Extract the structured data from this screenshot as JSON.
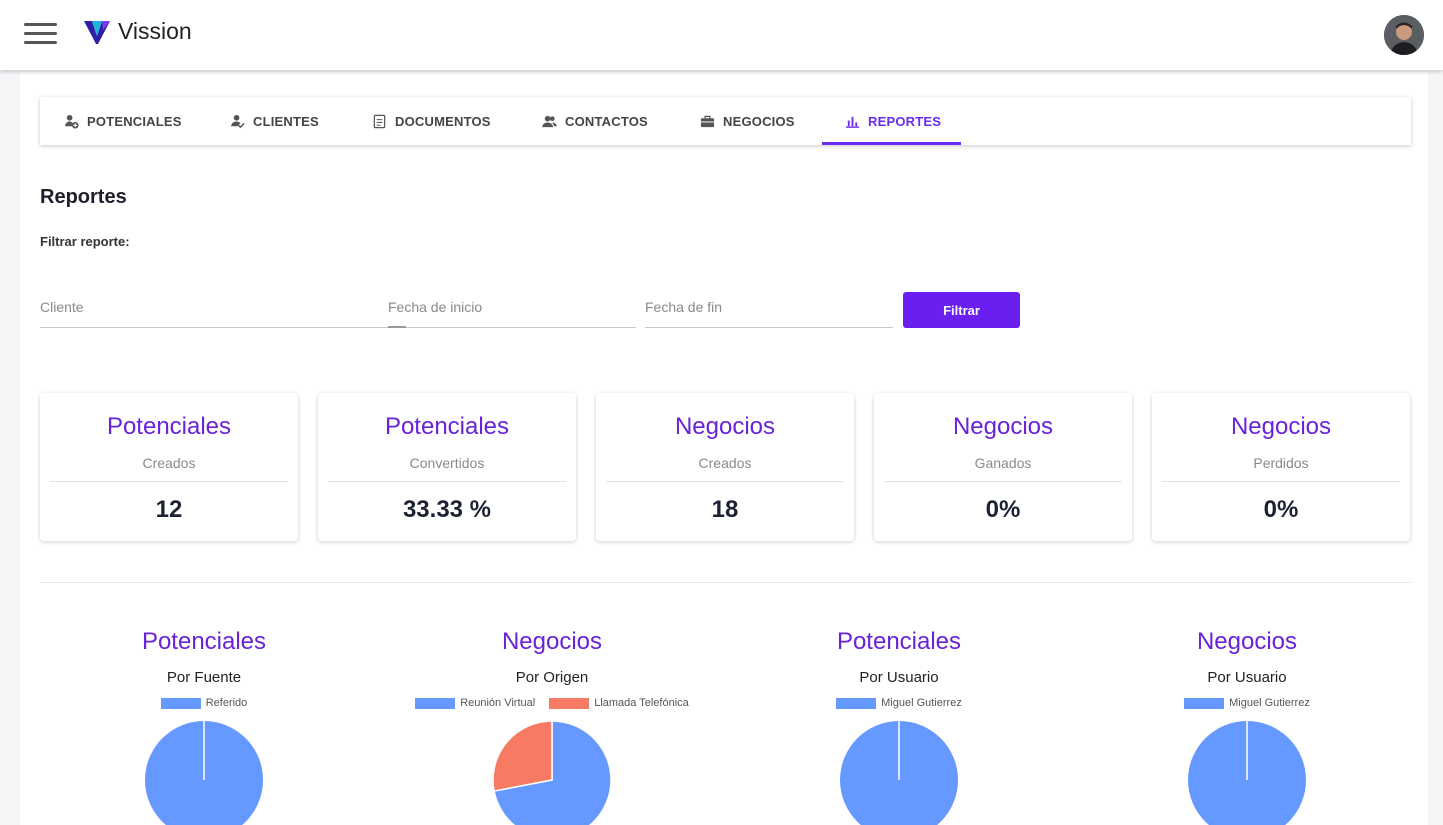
{
  "app": {
    "brand": "Vission"
  },
  "tabs": [
    {
      "label": "POTENCIALES",
      "icon": "person-add-icon",
      "active": false
    },
    {
      "label": "CLIENTES",
      "icon": "person-check-icon",
      "active": false
    },
    {
      "label": "DOCUMENTOS",
      "icon": "document-icon",
      "active": false
    },
    {
      "label": "CONTACTOS",
      "icon": "contacts-icon",
      "active": false
    },
    {
      "label": "NEGOCIOS",
      "icon": "briefcase-icon",
      "active": false
    },
    {
      "label": "REPORTES",
      "icon": "bar-chart-icon",
      "active": true
    }
  ],
  "page": {
    "title": "Reportes",
    "filter_label": "Filtrar reporte:"
  },
  "filters": {
    "cliente_placeholder": "Cliente",
    "inicio_placeholder": "Fecha de inicio",
    "fin_placeholder": "Fecha de fin",
    "button": "Filtrar"
  },
  "stats": [
    {
      "title": "Potenciales",
      "subtitle": "Creados",
      "value": "12"
    },
    {
      "title": "Potenciales",
      "subtitle": "Convertidos",
      "value": "33.33 %"
    },
    {
      "title": "Negocios",
      "subtitle": "Creados",
      "value": "18"
    },
    {
      "title": "Negocios",
      "subtitle": "Ganados",
      "value": "0%"
    },
    {
      "title": "Negocios",
      "subtitle": "Perdidos",
      "value": "0%"
    }
  ],
  "colors": {
    "accent": "#6a1ff0",
    "pie_blue": "#6699ff",
    "pie_red": "#f77b64"
  },
  "chart_data": [
    {
      "type": "pie",
      "title": "Potenciales",
      "subtitle": "Por Fuente",
      "categories": [
        "Referido"
      ],
      "values": [
        1
      ]
    },
    {
      "type": "pie",
      "title": "Negocios",
      "subtitle": "Por Origen",
      "categories": [
        "Reunión Virtual",
        "Llamada Telefónica"
      ],
      "values": [
        0.72,
        0.28
      ]
    },
    {
      "type": "pie",
      "title": "Potenciales",
      "subtitle": "Por Usuario",
      "categories": [
        "Miguel Gutierrez"
      ],
      "values": [
        1
      ]
    },
    {
      "type": "pie",
      "title": "Negocios",
      "subtitle": "Por Usuario",
      "categories": [
        "Miguel Gutierrez"
      ],
      "values": [
        1
      ]
    }
  ]
}
